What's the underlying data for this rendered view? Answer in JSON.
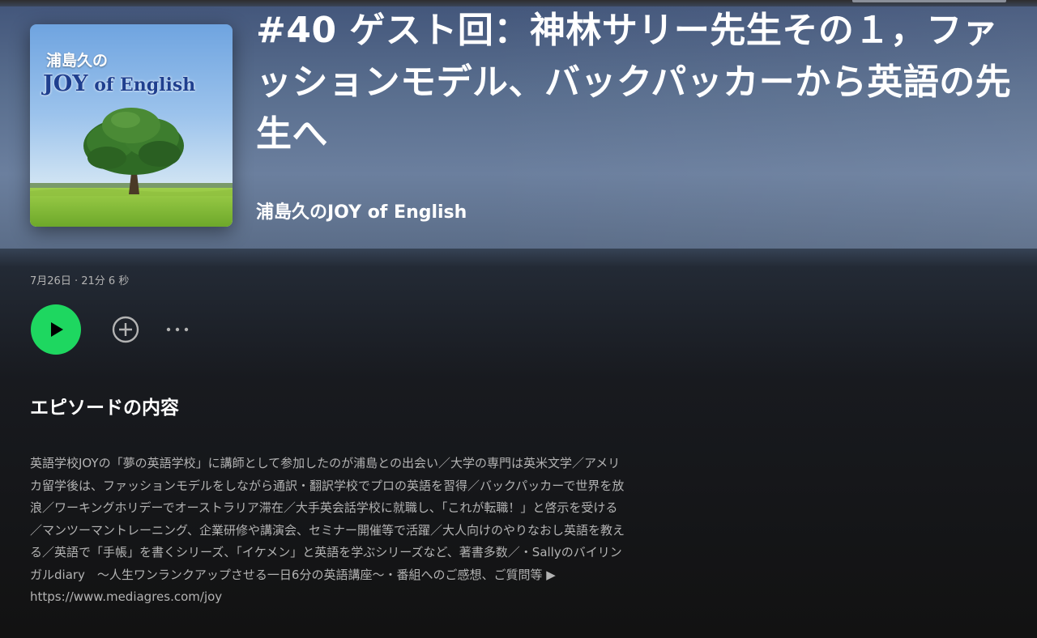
{
  "episode": {
    "title": "#40 ゲスト回：神林サリー先生その１，ファッションモデル、バックパッカーから英語の先生へ",
    "show_name": "浦島久のJOY of English",
    "date": "7月26日",
    "separator": "·",
    "duration": "21分 6 秒"
  },
  "cover": {
    "line1": "浦島久の",
    "line2_big": "JOY",
    "line2_small": " of English"
  },
  "actions": {
    "play_icon": "play-icon",
    "add_icon": "plus-circle-icon",
    "more_icon": "more-horizontal-icon"
  },
  "section": {
    "heading": "エピソードの内容"
  },
  "description": {
    "text": "英語学校JOYの「夢の英語学校」に講師として参加したのが浦島との出会い／大学の専門は英米文学／アメリカ留学後は、ファッションモデルをしながら通訳・翻訳学校でプロの英語を習得／バックパッカーで世界を放浪／ワーキングホリデーでオーストラリア滞在／大手英会話学校に就職し、「これが転職！」と啓示を受ける／マンツーマントレーニング、企業研修や講演会、セミナー開催等で活躍／大人向けのやりなおし英語を教える／英語で「手帳」を書くシリーズ、「イケメン」と英語を学ぶシリーズなど、著書多数／・Sallyのバイリンガルdiary　〜人生ワンランクアップさせる一日6分の英語講座〜・番組へのご感想、ご質問等 ▶",
    "link": "https://www.mediagres.com/joy"
  },
  "colors": {
    "accent": "#1ed760",
    "background": "#121212",
    "hero": "#586d8d",
    "text_secondary": "#b3b3b3"
  }
}
